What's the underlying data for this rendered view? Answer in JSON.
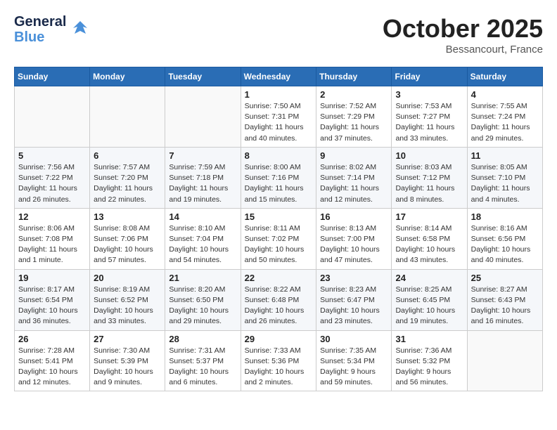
{
  "header": {
    "logo_general": "General",
    "logo_blue": "Blue",
    "month": "October 2025",
    "location": "Bessancourt, France"
  },
  "weekdays": [
    "Sunday",
    "Monday",
    "Tuesday",
    "Wednesday",
    "Thursday",
    "Friday",
    "Saturday"
  ],
  "weeks": [
    [
      {
        "day": "",
        "sunrise": "",
        "sunset": "",
        "daylight": ""
      },
      {
        "day": "",
        "sunrise": "",
        "sunset": "",
        "daylight": ""
      },
      {
        "day": "",
        "sunrise": "",
        "sunset": "",
        "daylight": ""
      },
      {
        "day": "1",
        "sunrise": "Sunrise: 7:50 AM",
        "sunset": "Sunset: 7:31 PM",
        "daylight": "Daylight: 11 hours and 40 minutes."
      },
      {
        "day": "2",
        "sunrise": "Sunrise: 7:52 AM",
        "sunset": "Sunset: 7:29 PM",
        "daylight": "Daylight: 11 hours and 37 minutes."
      },
      {
        "day": "3",
        "sunrise": "Sunrise: 7:53 AM",
        "sunset": "Sunset: 7:27 PM",
        "daylight": "Daylight: 11 hours and 33 minutes."
      },
      {
        "day": "4",
        "sunrise": "Sunrise: 7:55 AM",
        "sunset": "Sunset: 7:24 PM",
        "daylight": "Daylight: 11 hours and 29 minutes."
      }
    ],
    [
      {
        "day": "5",
        "sunrise": "Sunrise: 7:56 AM",
        "sunset": "Sunset: 7:22 PM",
        "daylight": "Daylight: 11 hours and 26 minutes."
      },
      {
        "day": "6",
        "sunrise": "Sunrise: 7:57 AM",
        "sunset": "Sunset: 7:20 PM",
        "daylight": "Daylight: 11 hours and 22 minutes."
      },
      {
        "day": "7",
        "sunrise": "Sunrise: 7:59 AM",
        "sunset": "Sunset: 7:18 PM",
        "daylight": "Daylight: 11 hours and 19 minutes."
      },
      {
        "day": "8",
        "sunrise": "Sunrise: 8:00 AM",
        "sunset": "Sunset: 7:16 PM",
        "daylight": "Daylight: 11 hours and 15 minutes."
      },
      {
        "day": "9",
        "sunrise": "Sunrise: 8:02 AM",
        "sunset": "Sunset: 7:14 PM",
        "daylight": "Daylight: 11 hours and 12 minutes."
      },
      {
        "day": "10",
        "sunrise": "Sunrise: 8:03 AM",
        "sunset": "Sunset: 7:12 PM",
        "daylight": "Daylight: 11 hours and 8 minutes."
      },
      {
        "day": "11",
        "sunrise": "Sunrise: 8:05 AM",
        "sunset": "Sunset: 7:10 PM",
        "daylight": "Daylight: 11 hours and 4 minutes."
      }
    ],
    [
      {
        "day": "12",
        "sunrise": "Sunrise: 8:06 AM",
        "sunset": "Sunset: 7:08 PM",
        "daylight": "Daylight: 11 hours and 1 minute."
      },
      {
        "day": "13",
        "sunrise": "Sunrise: 8:08 AM",
        "sunset": "Sunset: 7:06 PM",
        "daylight": "Daylight: 10 hours and 57 minutes."
      },
      {
        "day": "14",
        "sunrise": "Sunrise: 8:10 AM",
        "sunset": "Sunset: 7:04 PM",
        "daylight": "Daylight: 10 hours and 54 minutes."
      },
      {
        "day": "15",
        "sunrise": "Sunrise: 8:11 AM",
        "sunset": "Sunset: 7:02 PM",
        "daylight": "Daylight: 10 hours and 50 minutes."
      },
      {
        "day": "16",
        "sunrise": "Sunrise: 8:13 AM",
        "sunset": "Sunset: 7:00 PM",
        "daylight": "Daylight: 10 hours and 47 minutes."
      },
      {
        "day": "17",
        "sunrise": "Sunrise: 8:14 AM",
        "sunset": "Sunset: 6:58 PM",
        "daylight": "Daylight: 10 hours and 43 minutes."
      },
      {
        "day": "18",
        "sunrise": "Sunrise: 8:16 AM",
        "sunset": "Sunset: 6:56 PM",
        "daylight": "Daylight: 10 hours and 40 minutes."
      }
    ],
    [
      {
        "day": "19",
        "sunrise": "Sunrise: 8:17 AM",
        "sunset": "Sunset: 6:54 PM",
        "daylight": "Daylight: 10 hours and 36 minutes."
      },
      {
        "day": "20",
        "sunrise": "Sunrise: 8:19 AM",
        "sunset": "Sunset: 6:52 PM",
        "daylight": "Daylight: 10 hours and 33 minutes."
      },
      {
        "day": "21",
        "sunrise": "Sunrise: 8:20 AM",
        "sunset": "Sunset: 6:50 PM",
        "daylight": "Daylight: 10 hours and 29 minutes."
      },
      {
        "day": "22",
        "sunrise": "Sunrise: 8:22 AM",
        "sunset": "Sunset: 6:48 PM",
        "daylight": "Daylight: 10 hours and 26 minutes."
      },
      {
        "day": "23",
        "sunrise": "Sunrise: 8:23 AM",
        "sunset": "Sunset: 6:47 PM",
        "daylight": "Daylight: 10 hours and 23 minutes."
      },
      {
        "day": "24",
        "sunrise": "Sunrise: 8:25 AM",
        "sunset": "Sunset: 6:45 PM",
        "daylight": "Daylight: 10 hours and 19 minutes."
      },
      {
        "day": "25",
        "sunrise": "Sunrise: 8:27 AM",
        "sunset": "Sunset: 6:43 PM",
        "daylight": "Daylight: 10 hours and 16 minutes."
      }
    ],
    [
      {
        "day": "26",
        "sunrise": "Sunrise: 7:28 AM",
        "sunset": "Sunset: 5:41 PM",
        "daylight": "Daylight: 10 hours and 12 minutes."
      },
      {
        "day": "27",
        "sunrise": "Sunrise: 7:30 AM",
        "sunset": "Sunset: 5:39 PM",
        "daylight": "Daylight: 10 hours and 9 minutes."
      },
      {
        "day": "28",
        "sunrise": "Sunrise: 7:31 AM",
        "sunset": "Sunset: 5:37 PM",
        "daylight": "Daylight: 10 hours and 6 minutes."
      },
      {
        "day": "29",
        "sunrise": "Sunrise: 7:33 AM",
        "sunset": "Sunset: 5:36 PM",
        "daylight": "Daylight: 10 hours and 2 minutes."
      },
      {
        "day": "30",
        "sunrise": "Sunrise: 7:35 AM",
        "sunset": "Sunset: 5:34 PM",
        "daylight": "Daylight: 9 hours and 59 minutes."
      },
      {
        "day": "31",
        "sunrise": "Sunrise: 7:36 AM",
        "sunset": "Sunset: 5:32 PM",
        "daylight": "Daylight: 9 hours and 56 minutes."
      },
      {
        "day": "",
        "sunrise": "",
        "sunset": "",
        "daylight": ""
      }
    ]
  ]
}
